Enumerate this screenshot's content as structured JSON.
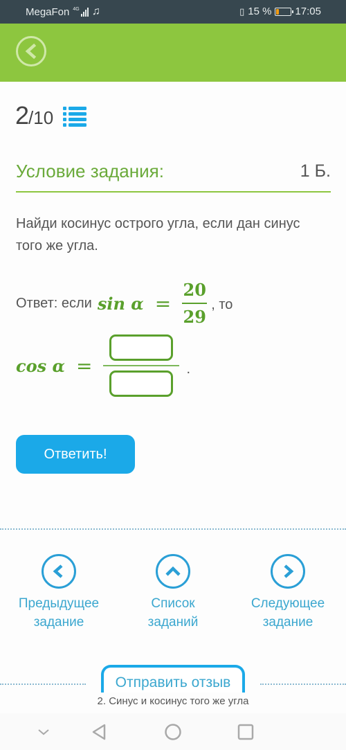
{
  "status_bar": {
    "carrier": "MegaFon",
    "network": "4G",
    "battery_percent_text": "15 %",
    "battery_level": 0.15,
    "time": "17:05",
    "icons": [
      "signal-icon",
      "music-icon",
      "vibrate-icon",
      "battery-icon"
    ]
  },
  "header": {
    "back_icon": "chevron-left-icon",
    "color": "#8dc63f"
  },
  "counter": {
    "current": "2",
    "total": "/10",
    "list_icon": "list-icon"
  },
  "section": {
    "title": "Условие задания:",
    "points": "1 Б."
  },
  "task": {
    "text": "Найди косинус острого угла, если дан синус того же угла.",
    "answer_prefix": "Ответ: если",
    "sin_expr": "sin α",
    "equals": "=",
    "numerator": "20",
    "denominator": "29",
    "answer_middle": ", то",
    "cos_expr": "cos α",
    "numerator_input": {
      "value": "",
      "placeholder": ""
    },
    "denominator_input": {
      "value": "",
      "placeholder": ""
    },
    "period": "."
  },
  "submit": {
    "label": "Ответить!",
    "color": "#1ba9e8"
  },
  "navigation": {
    "prev": {
      "line1": "Предыдущее",
      "line2": "задание",
      "icon": "chevron-left-icon"
    },
    "list": {
      "line1": "Список",
      "line2": "заданий",
      "icon": "chevron-up-icon"
    },
    "next": {
      "line1": "Следующее",
      "line2": "задание",
      "icon": "chevron-right-icon"
    }
  },
  "feedback": {
    "label": "Отправить отзыв"
  },
  "footer": {
    "caption": "2. Синус и косинус того же угла"
  },
  "android_nav": [
    "hide-keyboard-icon",
    "back-icon",
    "home-icon",
    "recents-icon"
  ]
}
